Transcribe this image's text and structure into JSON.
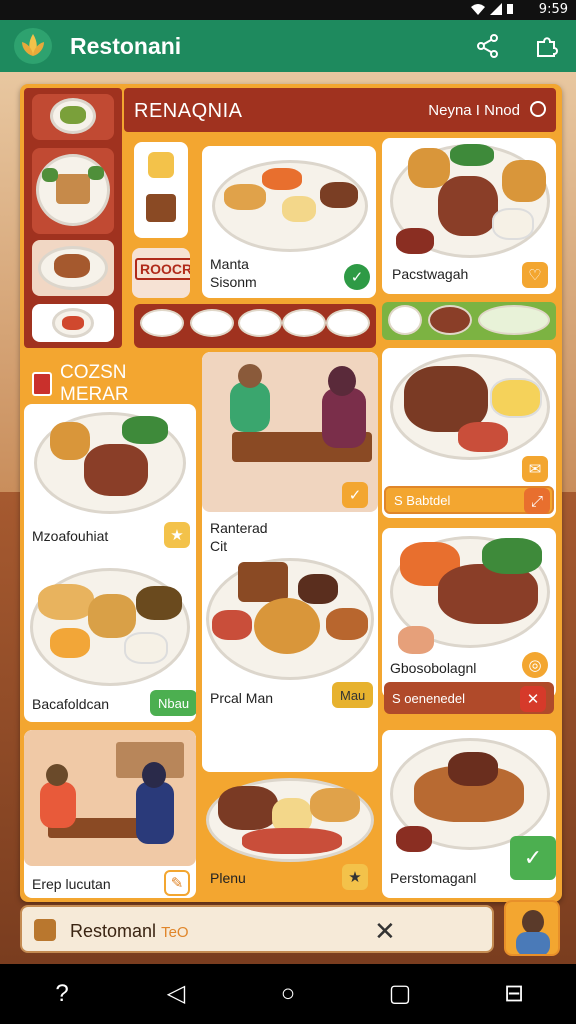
{
  "status_bar": {
    "time": "9:59"
  },
  "app": {
    "title": "Restonani"
  },
  "header": {
    "title": "RENAQNIA",
    "subtitle": "Neyna I Nnod"
  },
  "left_column": {
    "tag": "ROOCR"
  },
  "cards": {
    "top_middle": {
      "label_line1": "Manta",
      "label_line2": "Sisonm"
    },
    "top_right": {
      "label": "Pacstwagah"
    },
    "section_label": "COZSN MERAR",
    "left_mid": {
      "label": "Mzoafouhiat"
    },
    "center_scene": {
      "label_line1": "Ranterad",
      "label_line2": "Cit"
    },
    "right_mid_top": {
      "pill": "S Babtdel"
    },
    "left_lower": {
      "label": "Bacafoldcan",
      "pill": "Nbau"
    },
    "center_lower": {
      "label": "Prcal Man",
      "pill": "Mau"
    },
    "right_mid_lower": {
      "label": "Gbosobolagnl",
      "pill": "S oenenedel"
    },
    "left_bottom": {
      "label": "Erep lucutan"
    },
    "center_bottom": {
      "label": "Plenu"
    },
    "right_bottom": {
      "label": "Perstomaganl"
    }
  },
  "bottom_bar": {
    "text": "Restomanl",
    "suffix": "TeO"
  },
  "colors": {
    "app_bar": "#1e8a5e",
    "panel": "#f3a630",
    "header": "#a0321f",
    "accent_green": "#4caf50"
  },
  "icons": {
    "share": "share-icon",
    "puzzle": "puzzle-icon",
    "close": "close-icon",
    "check": "check-icon"
  }
}
